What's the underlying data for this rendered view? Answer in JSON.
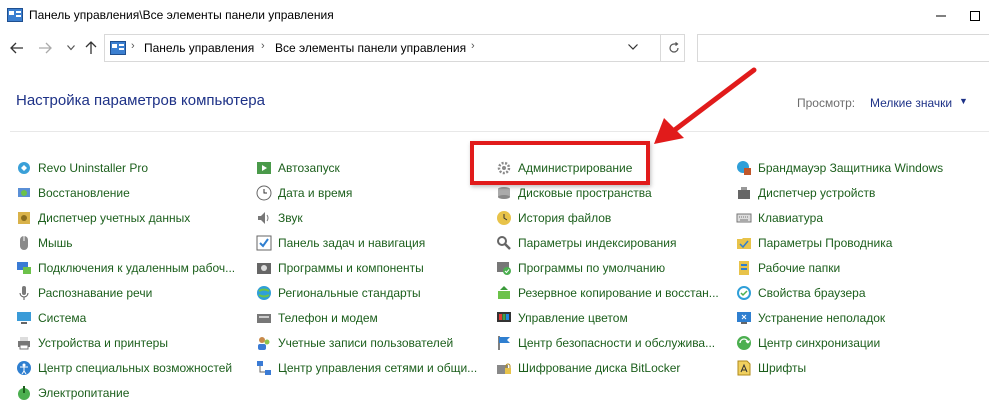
{
  "window": {
    "title": "Панель управления\\Все элементы панели управления"
  },
  "nav": {
    "breadcrumb": [
      "Панель управления",
      "Все элементы панели управления"
    ],
    "search_placeholder": ""
  },
  "header": {
    "title": "Настройка параметров компьютера",
    "view_label": "Просмотр:",
    "view_value": "Мелкие значки"
  },
  "columns": [
    [
      {
        "label": "Revo Uninstaller Pro",
        "icon": "revo-uninstaller-icon"
      },
      {
        "label": "Восстановление",
        "icon": "recovery-icon"
      },
      {
        "label": "Диспетчер учетных данных",
        "icon": "credential-manager-icon"
      },
      {
        "label": "Мышь",
        "icon": "mouse-icon"
      },
      {
        "label": "Подключения к удаленным рабоч...",
        "icon": "remote-desktop-icon"
      },
      {
        "label": "Распознавание речи",
        "icon": "microphone-icon"
      },
      {
        "label": "Система",
        "icon": "system-icon"
      },
      {
        "label": "Устройства и принтеры",
        "icon": "devices-printers-icon"
      },
      {
        "label": "Центр специальных возможностей",
        "icon": "ease-of-access-icon"
      },
      {
        "label": "Электропитание",
        "icon": "power-options-icon"
      }
    ],
    [
      {
        "label": "Автозапуск",
        "icon": "autoplay-icon"
      },
      {
        "label": "Дата и время",
        "icon": "date-time-icon"
      },
      {
        "label": "Звук",
        "icon": "sound-icon"
      },
      {
        "label": "Панель задач и навигация",
        "icon": "taskbar-icon"
      },
      {
        "label": "Программы и компоненты",
        "icon": "programs-features-icon"
      },
      {
        "label": "Региональные стандарты",
        "icon": "region-icon"
      },
      {
        "label": "Телефон и модем",
        "icon": "phone-modem-icon"
      },
      {
        "label": "Учетные записи пользователей",
        "icon": "user-accounts-icon"
      },
      {
        "label": "Центр управления сетями и общи...",
        "icon": "network-center-icon"
      }
    ],
    [
      {
        "label": "Администрирование",
        "icon": "administrative-tools-icon"
      },
      {
        "label": "Дисковые пространства",
        "icon": "storage-spaces-icon"
      },
      {
        "label": "История файлов",
        "icon": "file-history-icon"
      },
      {
        "label": "Параметры индексирования",
        "icon": "indexing-options-icon"
      },
      {
        "label": "Программы по умолчанию",
        "icon": "default-programs-icon"
      },
      {
        "label": "Резервное копирование и восстан...",
        "icon": "backup-restore-icon"
      },
      {
        "label": "Управление цветом",
        "icon": "color-management-icon"
      },
      {
        "label": "Центр безопасности и обслужива...",
        "icon": "security-maintenance-icon"
      },
      {
        "label": "Шифрование диска BitLocker",
        "icon": "bitlocker-icon"
      }
    ],
    [
      {
        "label": "Брандмауэр Защитника Windows",
        "icon": "firewall-icon"
      },
      {
        "label": "Диспетчер устройств",
        "icon": "device-manager-icon"
      },
      {
        "label": "Клавиатура",
        "icon": "keyboard-icon"
      },
      {
        "label": "Параметры Проводника",
        "icon": "explorer-options-icon"
      },
      {
        "label": "Рабочие папки",
        "icon": "work-folders-icon"
      },
      {
        "label": "Свойства браузера",
        "icon": "internet-options-icon"
      },
      {
        "label": "Устранение неполадок",
        "icon": "troubleshooting-icon"
      },
      {
        "label": "Центр синхронизации",
        "icon": "sync-center-icon"
      },
      {
        "label": "Шрифты",
        "icon": "fonts-icon"
      }
    ]
  ],
  "colors": {
    "link": "#1c5f1c",
    "title": "#1e3287",
    "highlight": "#e11b1b"
  }
}
